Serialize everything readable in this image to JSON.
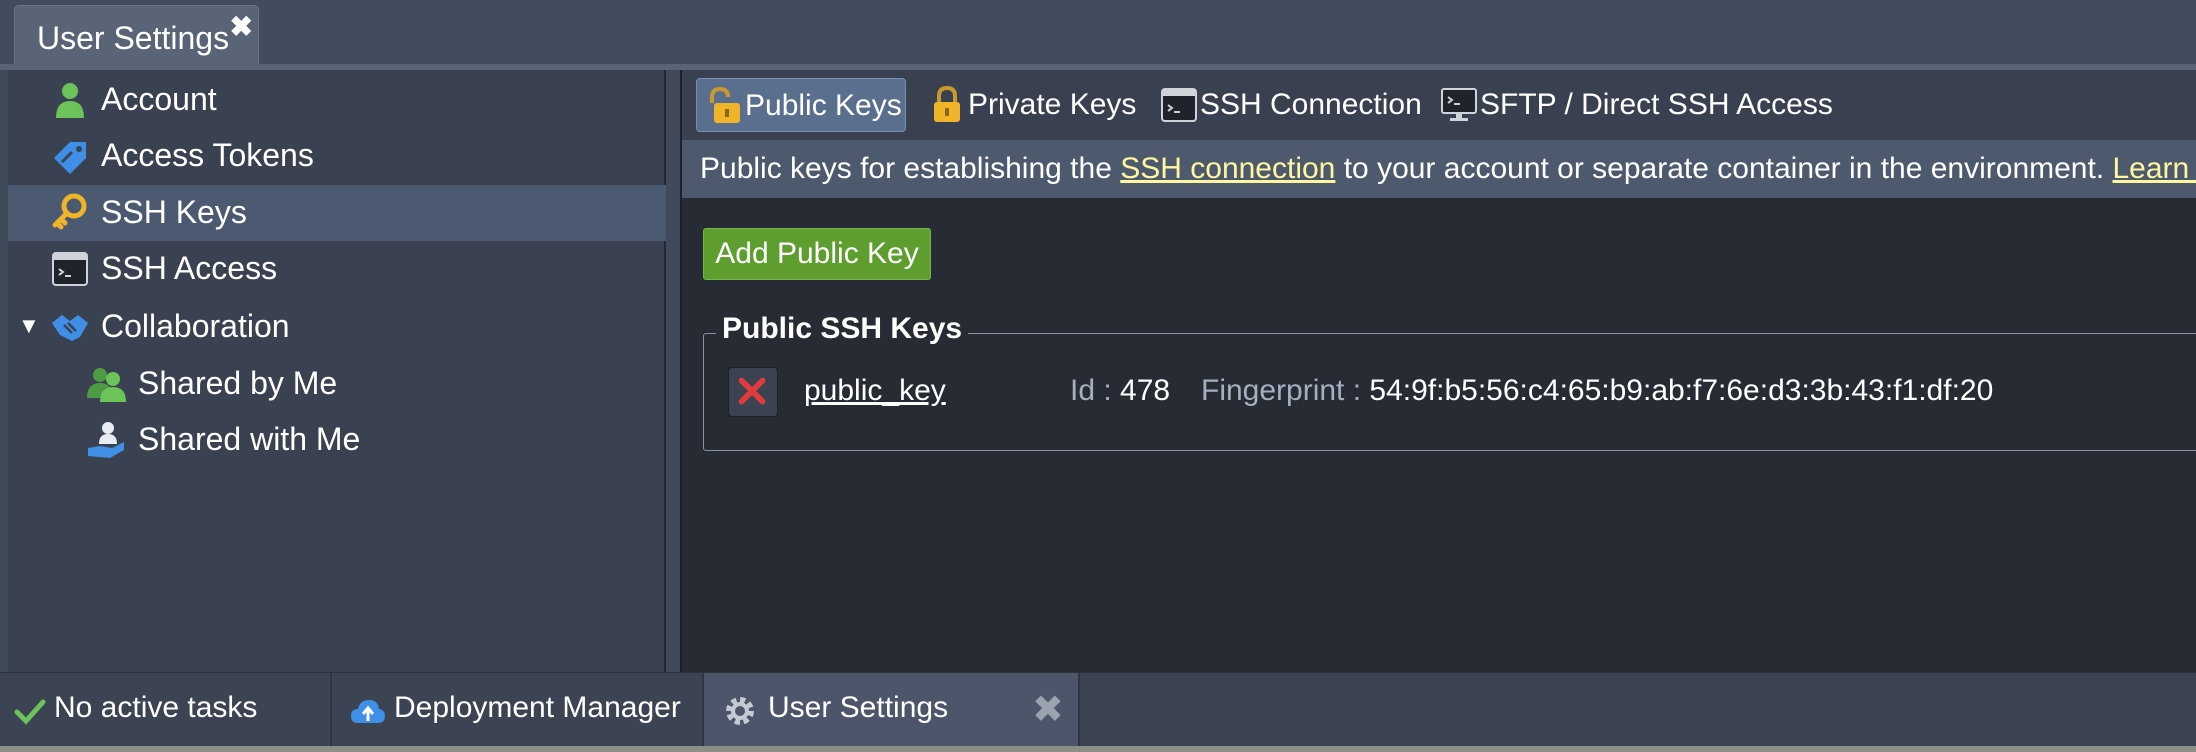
{
  "window": {
    "tab_title": "User Settings",
    "close_glyph": "✖"
  },
  "sidebar": {
    "items": [
      {
        "label": "Account",
        "icon": "user-icon"
      },
      {
        "label": "Access Tokens",
        "icon": "tag-icon"
      },
      {
        "label": "SSH Keys",
        "icon": "key-icon",
        "selected": true
      },
      {
        "label": "SSH Access",
        "icon": "terminal-icon"
      },
      {
        "label": "Collaboration",
        "icon": "handshake-icon",
        "expanded": true
      },
      {
        "label": "Shared by Me",
        "icon": "users-icon"
      },
      {
        "label": "Shared with Me",
        "icon": "hand-user-icon"
      }
    ],
    "expand_glyph": "▼"
  },
  "tabs": [
    {
      "label": "Public Keys",
      "icon": "unlocked-padlock-icon",
      "active": true
    },
    {
      "label": "Private Keys",
      "icon": "padlock-icon"
    },
    {
      "label": "SSH Connection",
      "icon": "terminal-icon"
    },
    {
      "label": "SFTP / Direct SSH Access",
      "icon": "monitor-terminal-icon"
    }
  ],
  "info": {
    "text_before": "Public keys for establishing the ",
    "link_ssh": "SSH connection",
    "text_after": " to your account or separate container in the environment. ",
    "link_learn": "Learn More"
  },
  "add_button": "Add Public Key",
  "keys_section": {
    "title": "Public SSH Keys",
    "keys": [
      {
        "name": "public_key",
        "id_label": "Id :",
        "id_value": "478",
        "fingerprint_label": "Fingerprint :",
        "fingerprint_value": "54:9f:b5:56:c4:65:b9:ab:f7:6e:d3:3b:43:f1:df:20"
      }
    ]
  },
  "taskbar": {
    "status": "No active tasks",
    "deployment_manager": "Deployment Manager",
    "user_settings": "User Settings",
    "close_glyph": "✖"
  },
  "colors": {
    "accent_green": "#5e9e2f",
    "selected_row": "#4b5a70",
    "link_yellow": "#fff7a0",
    "delete_red": "#e03c3c"
  }
}
